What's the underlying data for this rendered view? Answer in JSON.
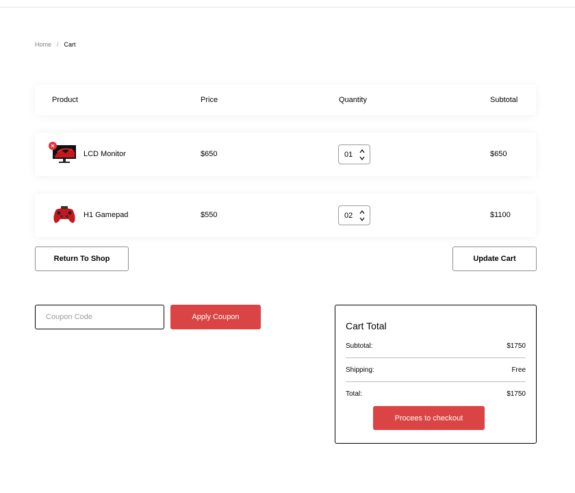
{
  "breadcrumb": {
    "home": "Home",
    "separator": "/",
    "current": "Cart"
  },
  "table": {
    "headers": {
      "product": "Product",
      "price": "Price",
      "quantity": "Quantity",
      "subtotal": "Subtotal"
    },
    "rows": [
      {
        "name": "LCD Monitor",
        "price": "$650",
        "quantity": "01",
        "subtotal": "$650",
        "icon": "monitor-icon"
      },
      {
        "name": "H1 Gamepad",
        "price": "$550",
        "quantity": "02",
        "subtotal": "$1100",
        "icon": "gamepad-icon"
      }
    ]
  },
  "actions": {
    "return_label": "Return To Shop",
    "update_label": "Update Cart"
  },
  "coupon": {
    "placeholder": "Coupon Code",
    "apply_label": "Apply Coupon"
  },
  "cart_total": {
    "title": "Cart Total",
    "subtotal_label": "Subtotal:",
    "subtotal_value": "$1750",
    "shipping_label": "Shipping:",
    "shipping_value": "Free",
    "total_label": "Total:",
    "total_value": "$1750",
    "checkout_label": "Procees to checkout"
  },
  "colors": {
    "accent": "#db4444",
    "remove": "#e5313b"
  }
}
